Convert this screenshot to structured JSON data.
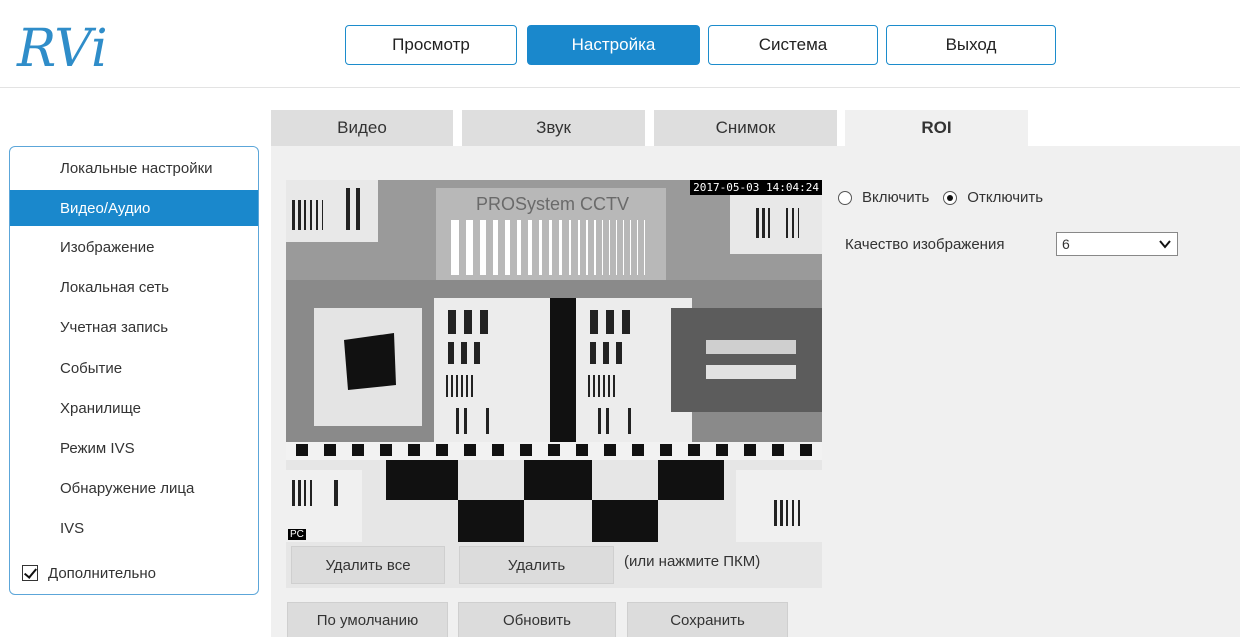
{
  "brand": {
    "logo_text": "RVi"
  },
  "top_nav": [
    {
      "label": "Просмотр",
      "active": false
    },
    {
      "label": "Настройка",
      "active": true
    },
    {
      "label": "Система",
      "active": false
    },
    {
      "label": "Выход",
      "active": false
    }
  ],
  "sidebar": {
    "items": [
      {
        "label": "Локальные настройки",
        "active": false
      },
      {
        "label": "Видео/Аудио",
        "active": true
      },
      {
        "label": "Изображение",
        "active": false
      },
      {
        "label": "Локальная сеть",
        "active": false
      },
      {
        "label": "Учетная запись",
        "active": false
      },
      {
        "label": "Событие",
        "active": false
      },
      {
        "label": "Хранилище",
        "active": false
      },
      {
        "label": "Режим IVS",
        "active": false
      },
      {
        "label": "Обнаружение лица",
        "active": false
      },
      {
        "label": "IVS",
        "active": false
      }
    ],
    "advanced": {
      "label": "Дополнительно",
      "checked": true
    }
  },
  "tabs": [
    {
      "label": "Видео",
      "active": false
    },
    {
      "label": "Звук",
      "active": false
    },
    {
      "label": "Снимок",
      "active": false
    },
    {
      "label": "ROI",
      "active": true
    }
  ],
  "video": {
    "timestamp": "2017-05-03 14:04:24",
    "corner_label": "PC",
    "watermark": "PROSystem CCTV"
  },
  "roi": {
    "enable_label": "Включить",
    "disable_label": "Отключить",
    "selected": "disable",
    "quality_label": "Качество изображения",
    "quality_value": "6"
  },
  "video_actions": {
    "delete_all": "Удалить все",
    "delete": "Удалить",
    "hint": "(или нажмите ПКМ)"
  },
  "footer_actions": {
    "default": "По умолчанию",
    "refresh": "Обновить",
    "save": "Сохранить"
  },
  "colors": {
    "accent": "#1a88cc",
    "logo": "#2f8dc9"
  }
}
